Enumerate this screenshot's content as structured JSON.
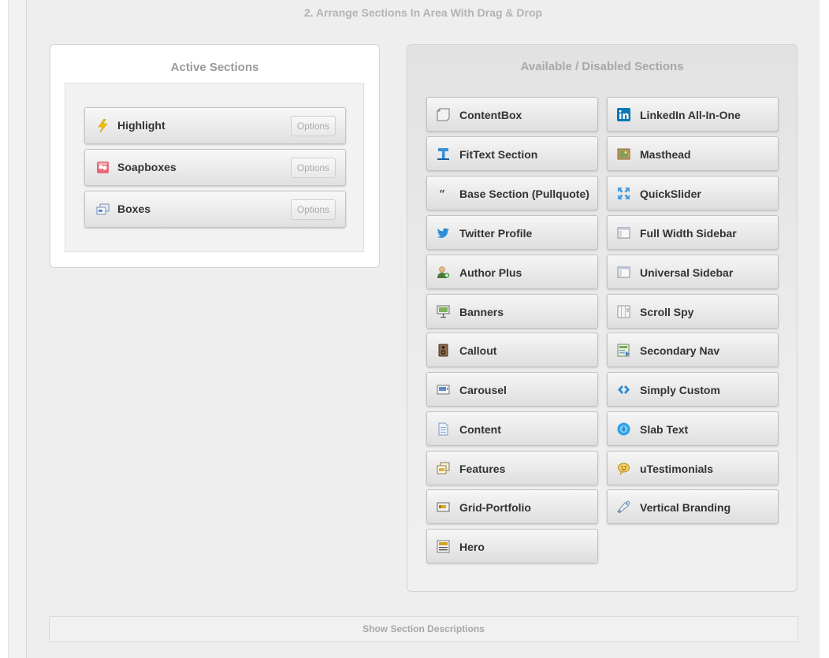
{
  "step_title": "2. Arrange Sections In Area With Drag & Drop",
  "active": {
    "title": "Active Sections",
    "items": [
      {
        "label": "Highlight",
        "icon": "lightning-icon",
        "options_label": "Options"
      },
      {
        "label": "Soapboxes",
        "icon": "soapbox-icon",
        "options_label": "Options"
      },
      {
        "label": "Boxes",
        "icon": "boxes-icon",
        "options_label": "Options"
      }
    ]
  },
  "available": {
    "title": "Available / Disabled Sections",
    "items": [
      {
        "label": "ContentBox",
        "icon": "contentbox-icon"
      },
      {
        "label": "LinkedIn All-In-One",
        "icon": "linkedin-icon"
      },
      {
        "label": "FitText Section",
        "icon": "fittext-icon"
      },
      {
        "label": "Masthead",
        "icon": "masthead-icon"
      },
      {
        "label": "Base Section (Pullquote)",
        "icon": "quote-icon"
      },
      {
        "label": "QuickSlider",
        "icon": "quickslider-icon"
      },
      {
        "label": "Twitter Profile",
        "icon": "twitter-icon"
      },
      {
        "label": "Full Width Sidebar",
        "icon": "sidebar-icon"
      },
      {
        "label": "Author Plus",
        "icon": "author-icon"
      },
      {
        "label": "Universal Sidebar",
        "icon": "sidebar-icon"
      },
      {
        "label": "Banners",
        "icon": "banner-icon"
      },
      {
        "label": "Scroll Spy",
        "icon": "scrollspy-icon"
      },
      {
        "label": "Callout",
        "icon": "callout-icon"
      },
      {
        "label": "Secondary Nav",
        "icon": "secondary-nav-icon"
      },
      {
        "label": "Carousel",
        "icon": "carousel-icon"
      },
      {
        "label": "Simply Custom",
        "icon": "code-icon"
      },
      {
        "label": "Content",
        "icon": "document-icon"
      },
      {
        "label": "Slab Text",
        "icon": "slabtext-icon"
      },
      {
        "label": "Features",
        "icon": "features-icon"
      },
      {
        "label": "uTestimonials",
        "icon": "testimonial-icon"
      },
      {
        "label": "Grid-Portfolio",
        "icon": "grid-portfolio-icon"
      },
      {
        "label": "Vertical Branding",
        "icon": "branding-icon"
      },
      {
        "label": "Hero",
        "icon": "hero-icon"
      }
    ]
  },
  "footer": {
    "show_descriptions_label": "Show Section Descriptions"
  }
}
